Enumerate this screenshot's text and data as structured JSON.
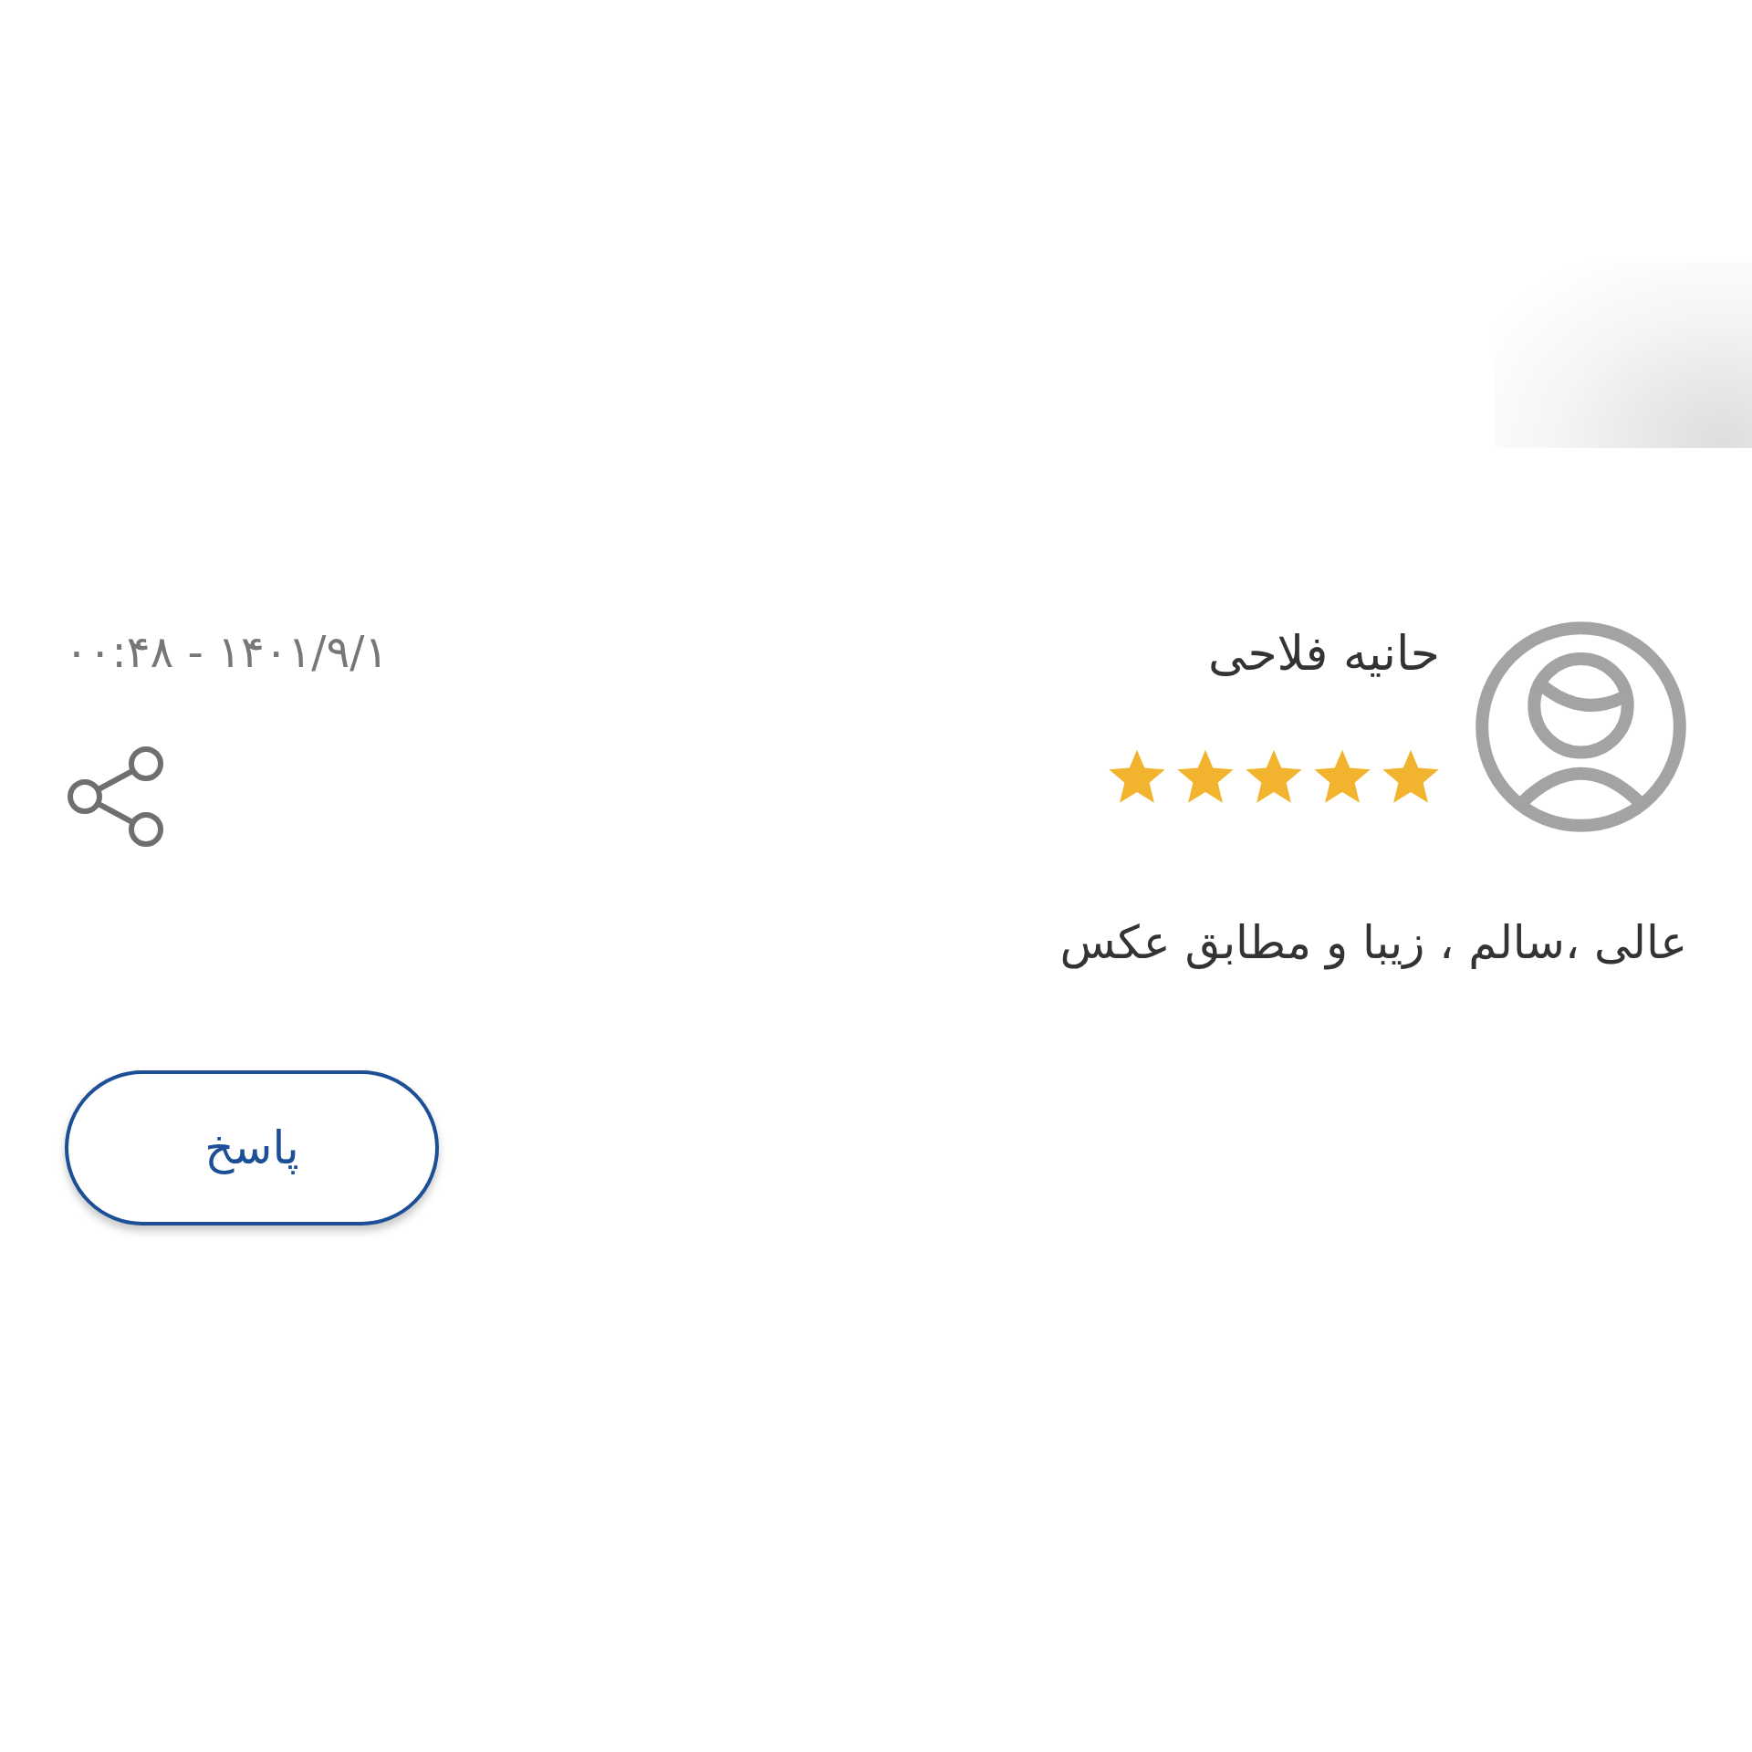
{
  "review": {
    "author": "حانیه فلاحی",
    "stars": 5,
    "date": "۱۴۰۱/۹/۱ - ۰۰:۴۸",
    "text": "عالی ،سالم ، زیبا و مطابق عکس"
  },
  "reply_button": {
    "label": "پاسخ"
  }
}
